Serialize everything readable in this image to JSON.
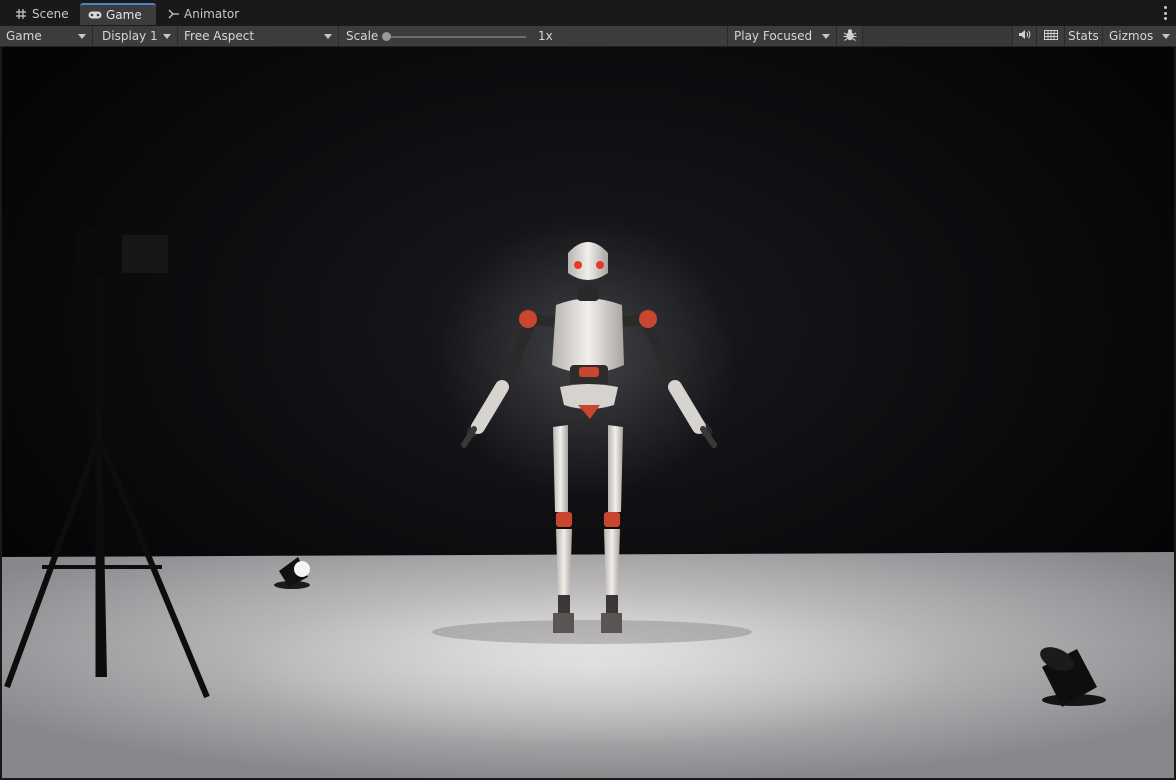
{
  "tabs": [
    {
      "label": "Scene",
      "icon": "grid-icon",
      "active": false
    },
    {
      "label": "Game",
      "icon": "gamepad-icon",
      "active": true
    },
    {
      "label": "Animator",
      "icon": "animator-icon",
      "active": false
    }
  ],
  "toolbar": {
    "game_view_label": "Game",
    "display_label": "Display 1",
    "aspect_label": "Free Aspect",
    "scale_label": "Scale",
    "scale_value": "1x",
    "play_mode_label": "Play Focused",
    "debug_icon": "bug-icon",
    "mute_icon": "speaker-icon",
    "stats_label": "Stats",
    "gizmos_label": "Gizmos"
  },
  "colors": {
    "tab_accent": "#4a86c7",
    "toolbar_bg": "#3c3c3c",
    "robot_eye": "#e8362a",
    "robot_accent": "#c8462e"
  }
}
